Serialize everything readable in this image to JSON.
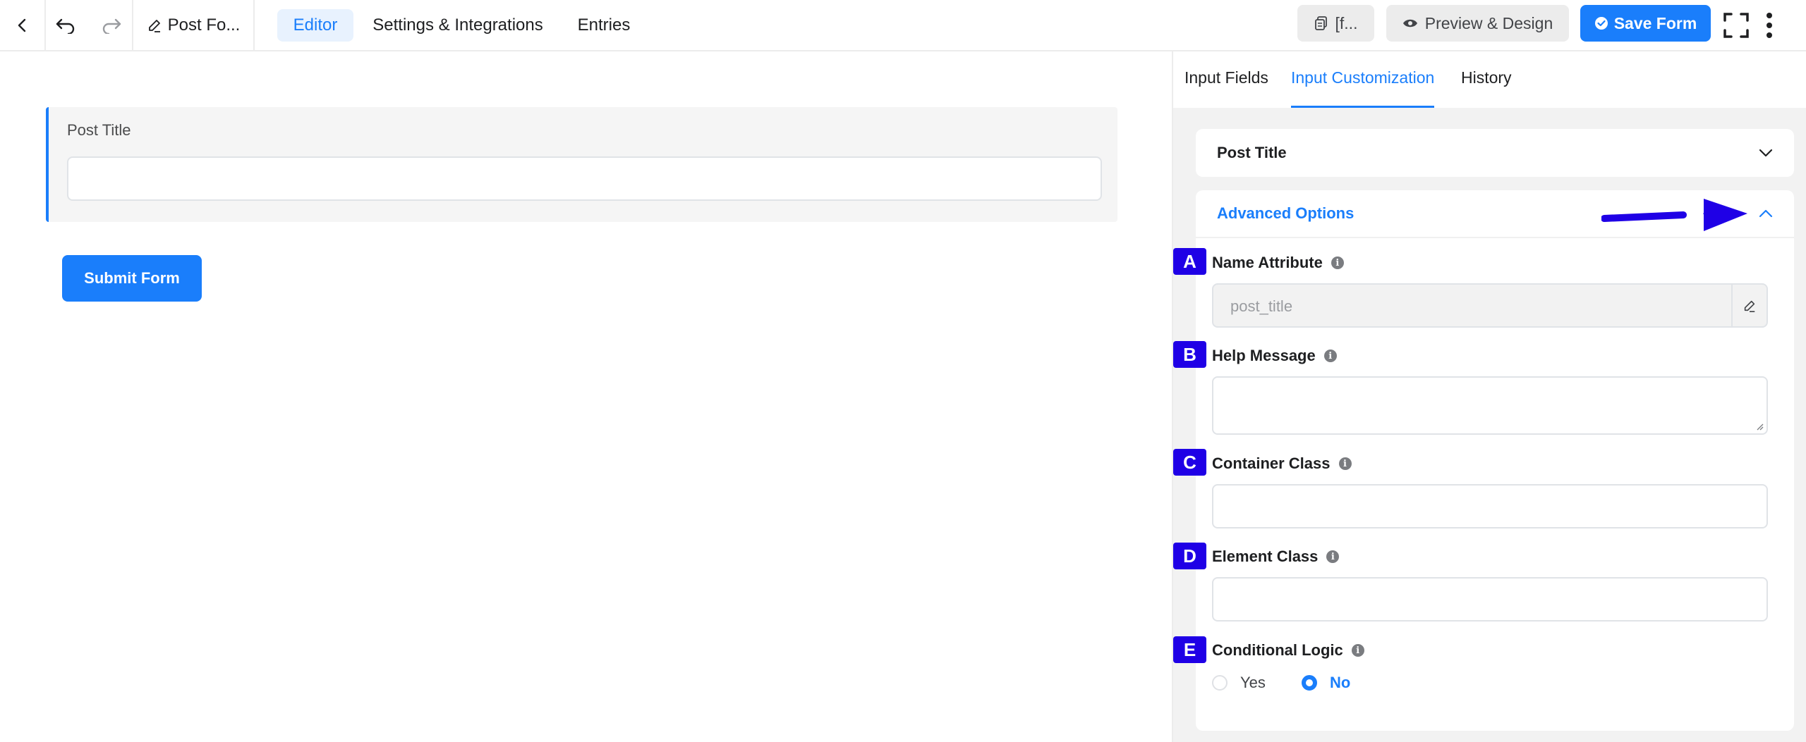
{
  "topbar": {
    "back_icon": "chevron-left-icon",
    "undo_icon": "undo-icon",
    "redo_icon": "redo-icon",
    "form_title": "Post Fo...",
    "tabs": [
      {
        "label": "Editor",
        "active": true
      },
      {
        "label": "Settings & Integrations",
        "active": false
      },
      {
        "label": "Entries",
        "active": false
      }
    ],
    "shortcode_label": "[f...",
    "preview_label": "Preview & Design",
    "save_label": "Save Form"
  },
  "canvas": {
    "field_label": "Post Title",
    "submit_label": "Submit Form"
  },
  "panel": {
    "tabs": [
      {
        "label": "Input Fields",
        "active": false
      },
      {
        "label": "Input Customization",
        "active": true
      },
      {
        "label": "History",
        "active": false
      }
    ],
    "section_title": "Post Title",
    "advanced_title": "Advanced Options",
    "fields": {
      "name_attribute": {
        "label": "Name Attribute",
        "placeholder": "post_title"
      },
      "help_message": {
        "label": "Help Message"
      },
      "container_class": {
        "label": "Container Class"
      },
      "element_class": {
        "label": "Element Class"
      },
      "conditional_logic": {
        "label": "Conditional Logic",
        "options": [
          "Yes",
          "No"
        ],
        "selected": "No"
      }
    }
  },
  "annotations": {
    "badges": [
      "A",
      "B",
      "C",
      "D",
      "E"
    ],
    "arrow_color": "#1f00e6"
  },
  "colors": {
    "accent": "#1a7efb",
    "badge": "#1f00e6"
  }
}
